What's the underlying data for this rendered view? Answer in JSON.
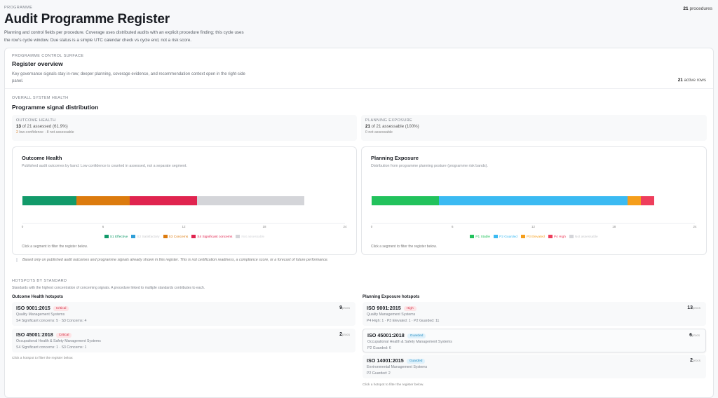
{
  "header": {
    "eyebrow": "PROGRAMME",
    "title": "Audit Programme Register",
    "description": "Planning and control fields per procedure. Coverage uses distributed audits with an explicit procedure finding; this cycle uses the row's cycle window. Due status is a simple UTC calendar check vs cycle end, not a risk score.",
    "procedure_count": "21",
    "procedure_label": "procedures"
  },
  "overview": {
    "eyebrow": "PROGRAMME CONTROL SURFACE",
    "title": "Register overview",
    "description": "Key governance signals stay in-row; deeper planning, coverage evidence, and recommendation context open in the right-side panel.",
    "active_count": "21",
    "active_label": "active rows"
  },
  "health": {
    "eyebrow": "OVERALL SYSTEM HEALTH",
    "title": "Programme signal distribution",
    "outcome_stat": {
      "label": "OUTCOME HEALTH",
      "count": "13",
      "text": "of 21 assessed (61.9%)",
      "low_conf": "2",
      "low_conf_text": "low-confidence",
      "rest": "· 8 not assessable"
    },
    "planning_stat": {
      "label": "PLANNING EXPOSURE",
      "count": "21",
      "text": "of 21 assessable (100%)",
      "rest": "0 not assessable"
    },
    "footnote": "Based only on published audit outcomes and programme signals already shown in this register. This is not certification readiness, a compliance score, or a forecast of future performance."
  },
  "chart_data": [
    {
      "type": "bar",
      "orientation": "horizontal-stacked",
      "title": "Outcome Health",
      "subtitle": "Published audit outcomes by band. Low confidence is counted in assessed, not a separate segment.",
      "xlim": [
        0,
        24
      ],
      "ticks": [
        "0",
        "6",
        "12",
        "18",
        "24"
      ],
      "legend": "bottom",
      "note": "Click a segment to filter the register below.",
      "series": [
        {
          "name": "S1 Effective",
          "value": 4,
          "color": "#129a6a"
        },
        {
          "name": "S2 Satisfactory",
          "value": 0,
          "color": "#2f9fd8"
        },
        {
          "name": "S3 Concerns",
          "value": 4,
          "color": "#dc7b0e"
        },
        {
          "name": "S4 Significant concerns",
          "value": 5,
          "color": "#e0244f"
        },
        {
          "name": "Not assessable",
          "value": 8,
          "color": "#d4d5d9"
        }
      ]
    },
    {
      "type": "bar",
      "orientation": "horizontal-stacked",
      "title": "Planning Exposure",
      "subtitle": "Distribution from programme planning posture (programme risk bands).",
      "xlim": [
        0,
        24
      ],
      "ticks": [
        "0",
        "6",
        "12",
        "18",
        "24"
      ],
      "legend": "bottom",
      "note": "Click a segment to filter the register below.",
      "series": [
        {
          "name": "P1 Stable",
          "value": 5,
          "color": "#22c25c"
        },
        {
          "name": "P2 Guarded",
          "value": 14,
          "color": "#3bbaf2"
        },
        {
          "name": "P3 Elevated",
          "value": 1,
          "color": "#f59e1b"
        },
        {
          "name": "P4 High",
          "value": 1,
          "color": "#ee3e5c"
        },
        {
          "name": "Not assessable",
          "value": 0,
          "color": "#d4d5d9"
        }
      ]
    }
  ],
  "hotspots": {
    "eyebrow": "HOTSPOTS BY STANDARD",
    "description": "Standards with the highest concentration of concerning signals. A procedure linked to multiple standards contributes to each.",
    "outcome": {
      "title": "Outcome Health hotspots",
      "note": "Click a hotspot to filter the register below.",
      "items": [
        {
          "name": "ISO 9001:2015",
          "badge": "Critical",
          "sub": "Quality Management Systems",
          "detail": "S4 Significant concerns: 5 · S3 Concerns: 4",
          "count": "9",
          "unit": "procs"
        },
        {
          "name": "ISO 45001:2018",
          "badge": "Critical",
          "sub": "Occupational Health & Safety Management Systems",
          "detail": "S4 Significant concerns: 1 · S3 Concerns: 1",
          "count": "2",
          "unit": "procs"
        }
      ]
    },
    "planning": {
      "title": "Planning Exposure hotspots",
      "note": "Click a hotspot to filter the register below.",
      "items": [
        {
          "name": "ISO 9001:2015",
          "badge": "High",
          "sub": "Quality Management Systems",
          "detail": "P4 High: 1 · P3 Elevated: 1 · P2 Guarded: 11",
          "count": "13",
          "unit": "procs"
        },
        {
          "name": "ISO 45001:2018",
          "badge": "Guarded",
          "sub": "Occupational Health & Safety Management Systems",
          "detail": "P2 Guarded: 6",
          "count": "6",
          "unit": "procs"
        },
        {
          "name": "ISO 14001:2015",
          "badge": "Guarded",
          "sub": "Environmental Management Systems",
          "detail": "P2 Guarded: 2",
          "count": "2",
          "unit": "procs"
        }
      ]
    }
  }
}
